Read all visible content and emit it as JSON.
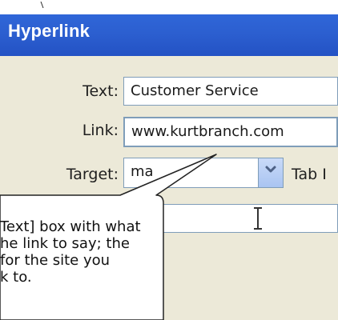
{
  "dialog": {
    "title": "Hyperlink"
  },
  "form": {
    "text_label": "Text:",
    "text_value": "Customer Service",
    "link_label": "Link:",
    "link_value": "www.kurtbranch.com",
    "target_label": "Target:",
    "target_value": "ma",
    "tab_index_label": "Tab I",
    "fourth_value": ""
  },
  "callout": {
    "lines": [
      "Text] box with what",
      "he link to say; the",
      "for the site you",
      "k to."
    ]
  },
  "colors": {
    "titlebar": "#2c5fd0",
    "dialog_bg": "#ece9d8",
    "field_border": "#7f9db9"
  },
  "icons": [
    "chevron-down-icon",
    "ibeam-cursor-icon"
  ]
}
